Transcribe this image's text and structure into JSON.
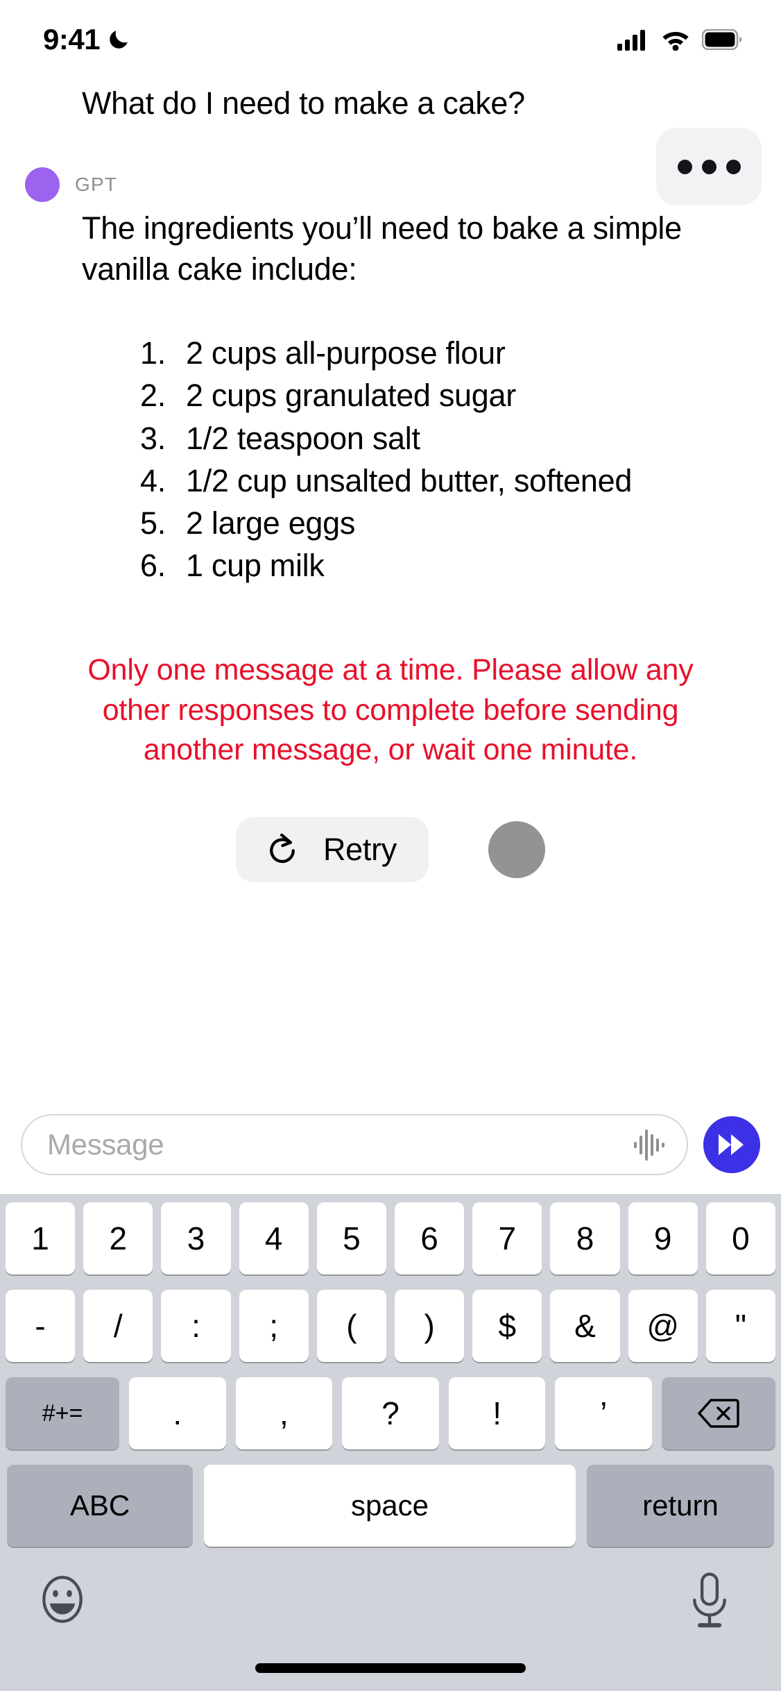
{
  "status_bar": {
    "time": "9:41",
    "dnd_icon": "crescent-moon-icon",
    "signal_icon": "cellular-signal-icon",
    "wifi_icon": "wifi-icon",
    "battery_icon": "battery-full-icon"
  },
  "conversation": {
    "user_message": "What do I need to make a cake?",
    "typing_indicator": {
      "name": "typing-indicator",
      "dots": 3
    },
    "assistant": {
      "avatar_color": "#9b63ee",
      "name": "GPT",
      "paragraph": "The ingredients you’ll need to bake a simple vanilla cake include:",
      "list": [
        {
          "num": "1.",
          "text": "2 cups all-purpose flour"
        },
        {
          "num": "2.",
          "text": "2 cups granulated sugar"
        },
        {
          "num": "3.",
          "text": "1/2 teaspoon salt"
        },
        {
          "num": "4.",
          "text": "1/2 cup unsalted butter, softened"
        },
        {
          "num": "5.",
          "text": "2 large eggs"
        },
        {
          "num": "6.",
          "text": "1 cup milk"
        }
      ]
    },
    "error_message": "Only one message at a time. Please allow any other responses to complete before sending another message, or wait one minute.",
    "error_color": "#e8102a",
    "retry_button": {
      "label": "Retry",
      "icon": "refresh-icon"
    },
    "placeholder_circle_color": "#939396"
  },
  "input_bar": {
    "placeholder": "Message",
    "waveform_icon": "audio-waveform-icon",
    "send_button": {
      "icon": "double-chevron-forward-icon",
      "color": "#3c31e6"
    }
  },
  "keyboard": {
    "row1": [
      "1",
      "2",
      "3",
      "4",
      "5",
      "6",
      "7",
      "8",
      "9",
      "0"
    ],
    "row2": [
      "-",
      "/",
      ":",
      ";",
      "(",
      ")",
      "$",
      "&",
      "@",
      "\""
    ],
    "row3": {
      "symbols_key": "#+=",
      "punct": [
        ".",
        ",",
        "?",
        "!",
        "’"
      ],
      "backspace_icon": "backspace-icon"
    },
    "row4": {
      "abc": "ABC",
      "space": "space",
      "return": "return"
    },
    "footer": {
      "emoji_icon": "emoji-smiley-icon",
      "mic_icon": "microphone-icon"
    }
  }
}
